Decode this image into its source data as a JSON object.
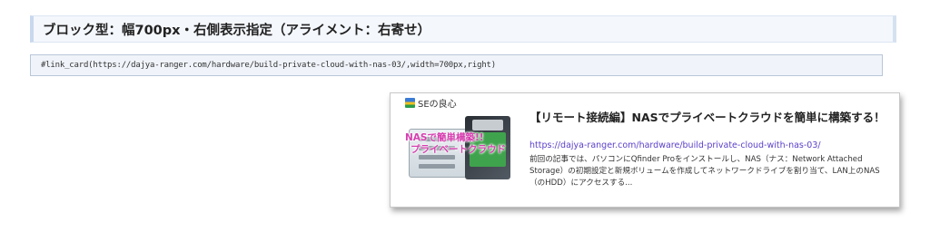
{
  "heading": "ブロック型：幅700px・右側表示指定（アライメント：右寄せ）",
  "code": "#link_card(https://dajya-ranger.com/hardware/build-private-cloud-with-nas-03/,width=700px,right)",
  "card": {
    "site_name": "SEの良心",
    "site_icon": "site-favicon",
    "thumbnail": {
      "line1": "NASで簡単構築!!",
      "line2": "プライベートクラウド"
    },
    "title": "【リモート接続編】NASでプライベートクラウドを簡単に構築する！",
    "url": "https://dajya-ranger.com/hardware/build-private-cloud-with-nas-03/",
    "description": "前回の記事では、パソコンにQfinder Proをインストールし、NAS（ナス：Network Attached Storage）の初期設定と新規ボリュームを作成してネットワークドライブを割り当て、LAN上のNAS（のHDD）にアクセスする..."
  },
  "colors": {
    "url": "#5b3fc9",
    "thumb_text": "#d63fb0",
    "heading_bg": "#f4f7fc"
  }
}
